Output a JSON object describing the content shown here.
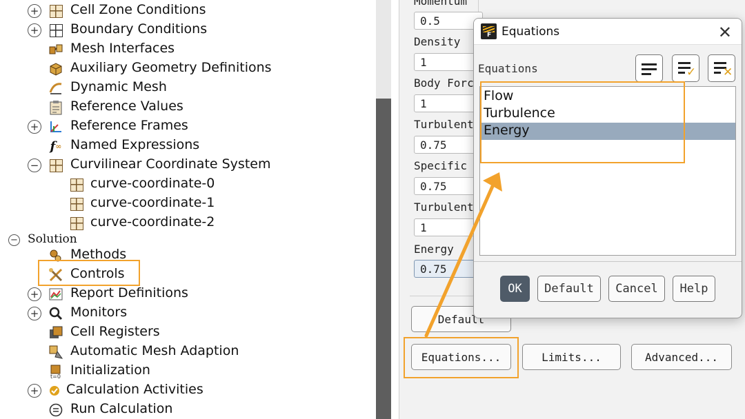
{
  "tree": {
    "items": [
      {
        "label": "Cell Zone Conditions",
        "expander": "+",
        "icon": "grid-icon"
      },
      {
        "label": "Boundary Conditions",
        "expander": "+",
        "icon": "grid-dark-icon"
      },
      {
        "label": "Mesh Interfaces",
        "expander": "",
        "icon": "mesh-interfaces-icon"
      },
      {
        "label": "Auxiliary Geometry Definitions",
        "expander": "",
        "icon": "cube-icon"
      },
      {
        "label": "Dynamic Mesh",
        "expander": "",
        "icon": "dynamic-mesh-icon"
      },
      {
        "label": "Reference Values",
        "expander": "",
        "icon": "clipboard-icon"
      },
      {
        "label": "Reference Frames",
        "expander": "+",
        "icon": "axes-icon"
      },
      {
        "label": "Named Expressions",
        "expander": "",
        "icon": "function-icon"
      },
      {
        "label": "Curvilinear Coordinate System",
        "expander": "−",
        "icon": "grid-icon"
      },
      {
        "label": "curve-coordinate-0",
        "expander": "",
        "icon": "grid-icon"
      },
      {
        "label": "curve-coordinate-1",
        "expander": "",
        "icon": "grid-icon"
      },
      {
        "label": "curve-coordinate-2",
        "expander": "",
        "icon": "grid-icon"
      },
      {
        "label": "Solution",
        "expander": "−",
        "icon": ""
      },
      {
        "label": "Methods",
        "expander": "",
        "icon": "methods-icon"
      },
      {
        "label": "Controls",
        "expander": "",
        "icon": "controls-icon"
      },
      {
        "label": "Report Definitions",
        "expander": "+",
        "icon": "report-icon"
      },
      {
        "label": "Monitors",
        "expander": "+",
        "icon": "magnifier-icon"
      },
      {
        "label": "Cell Registers",
        "expander": "",
        "icon": "cell-registers-icon"
      },
      {
        "label": "Automatic Mesh Adaption",
        "expander": "",
        "icon": "mesh-adaption-icon"
      },
      {
        "label": "Initialization",
        "expander": "",
        "icon": "initialization-icon"
      },
      {
        "label": "Calculation Activities",
        "expander": "+",
        "icon": "activities-icon"
      },
      {
        "label": "Run Calculation",
        "expander": "",
        "icon": "run-calculation-icon"
      }
    ]
  },
  "controls": {
    "fields": [
      {
        "label": "Momentum",
        "value": "0.5"
      },
      {
        "label": "Density",
        "value": "1"
      },
      {
        "label": "Body Forc",
        "value": "1"
      },
      {
        "label": "Turbulent",
        "value": "0.75"
      },
      {
        "label": "Specific",
        "value": "0.75"
      },
      {
        "label": "Turbulent",
        "value": "1"
      },
      {
        "label": "Energy",
        "value": "0.75"
      }
    ],
    "default_label": "Default",
    "equations_label": "Equations...",
    "limits_label": "Limits...",
    "advanced_label": "Advanced..."
  },
  "dialog": {
    "title": "Equations",
    "close": "✕",
    "list_label": "Equations",
    "items": [
      "Flow",
      "Turbulence",
      "Energy"
    ],
    "selected_index": 2,
    "buttons": {
      "ok": "OK",
      "default": "Default",
      "cancel": "Cancel",
      "help": "Help"
    }
  },
  "colors": {
    "highlight": "#f2a22c",
    "selection": "#98aabd",
    "primary_button": "#4f5b68"
  }
}
